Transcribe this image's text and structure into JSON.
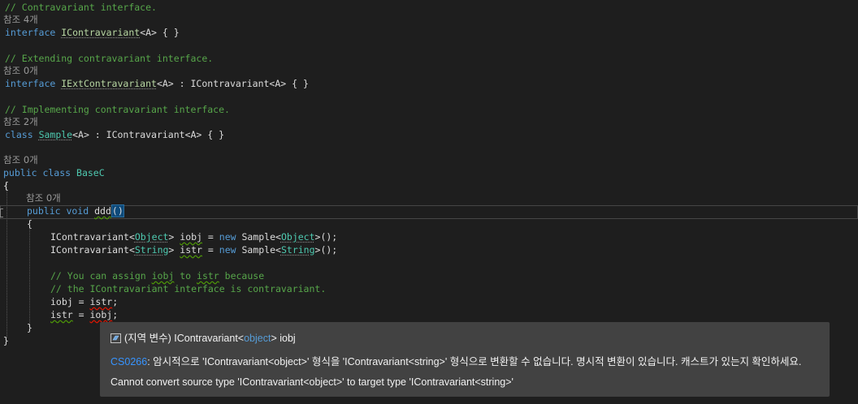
{
  "code": {
    "l1": "// Contravariant interface.",
    "lens1": "참조 4개",
    "kw_interface": "interface",
    "icontra": "IContravariant",
    "l3_tail": "<A> { }",
    "l5": "// Extending contravariant interface.",
    "lens2": "참조 0개",
    "iext": "IExtContravariant",
    "l7_tail": "<A> : IContravariant<A> { }",
    "l9": "// Implementing contravariant interface.",
    "lens3": "참조 2개",
    "kw_class": "class",
    "sample": "Sample",
    "l11_tail": "<A> : IContravariant<A> { }",
    "lens4": "참조 0개",
    "kw_public_class": "public class",
    "basec": "BaseC",
    "lbrace": "{",
    "rbrace": "}",
    "lens5": "참조 0개",
    "kw_public_void": "public void",
    "ddd": "ddd",
    "parens": "()",
    "icontra_plain": "IContravariant",
    "object": "Object",
    "string": "String",
    "iobj": "iobj",
    "istr": "istr",
    "kw_new": "new",
    "sample_plain": "Sample",
    "call_end": ">();",
    "c1a": "// You can assign ",
    "c1b": " to ",
    "c1c": " because",
    "c2": "// the IContravariant interface is contravariant."
  },
  "tooltip": {
    "prefix": "(지역 변수) ",
    "type_name": "IContravariant",
    "type_arg": "object",
    "var_name": "iobj",
    "error_code": "CS0266",
    "message_ko": ": 암시적으로 'IContravariant<object>' 형식을 'IContravariant<string>' 형식으로 변환할 수 없습니다. 명시적 변환이 있습니다. 캐스트가 있는지 확인하세요.",
    "message_en": "Cannot convert source type 'IContravariant<object>' to target type 'IContravariant<string>'"
  },
  "colors": {
    "background": "#1e1e1e",
    "comment": "#57a64a",
    "keyword": "#569cd6",
    "type": "#b8d7a3",
    "class": "#4ec9b0",
    "error": "#e51400",
    "tooltip_bg": "#424242",
    "link": "#3794ff"
  }
}
